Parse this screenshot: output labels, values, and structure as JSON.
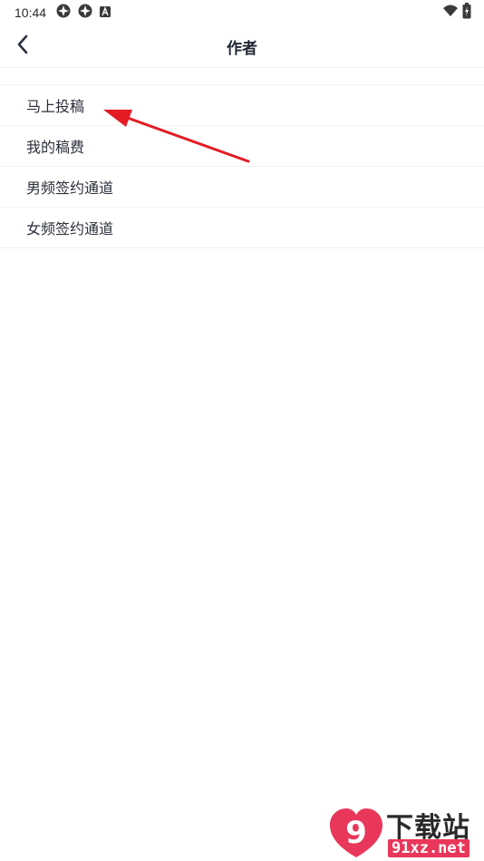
{
  "status_bar": {
    "time": "10:44",
    "icons_left": [
      "app-notification-icon",
      "app-notification-icon",
      "a-badge-icon"
    ],
    "icons_right": [
      "wifi-icon",
      "battery-charging-icon"
    ]
  },
  "header": {
    "back_icon": "chevron-left-icon",
    "title": "作者"
  },
  "menu": {
    "items": [
      {
        "label": "马上投稿"
      },
      {
        "label": "我的稿费"
      },
      {
        "label": "男频签约通道"
      },
      {
        "label": "女频签约通道"
      }
    ]
  },
  "annotation": {
    "arrow_color": "#e31b23"
  },
  "watermark": {
    "logo_text": "9",
    "text_cn": "下载站",
    "text_url": "91xz.net",
    "accent_color": "#e8375a"
  }
}
